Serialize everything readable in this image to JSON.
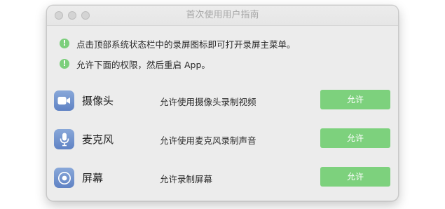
{
  "window": {
    "title": "首次使用用户指南"
  },
  "notices": [
    {
      "icon": "!",
      "text": "点击顶部系统状态栏中的录屏图标即可打开录屏主菜单。"
    },
    {
      "icon": "!",
      "text": "允许下面的权限，然后重启 App。"
    }
  ],
  "permissions": [
    {
      "icon": "camera-icon",
      "name": "摄像头",
      "desc": "允许使用摄像头录制视频",
      "button": "允许"
    },
    {
      "icon": "microphone-icon",
      "name": "麦克风",
      "desc": "允许使用麦克风录制声音",
      "button": "允许"
    },
    {
      "icon": "screen-record-icon",
      "name": "屏幕",
      "desc": "允许录制屏幕",
      "button": "允许"
    }
  ],
  "colors": {
    "accent_green": "#7dd17d",
    "app_icon_blue": "#6b8fcd"
  }
}
